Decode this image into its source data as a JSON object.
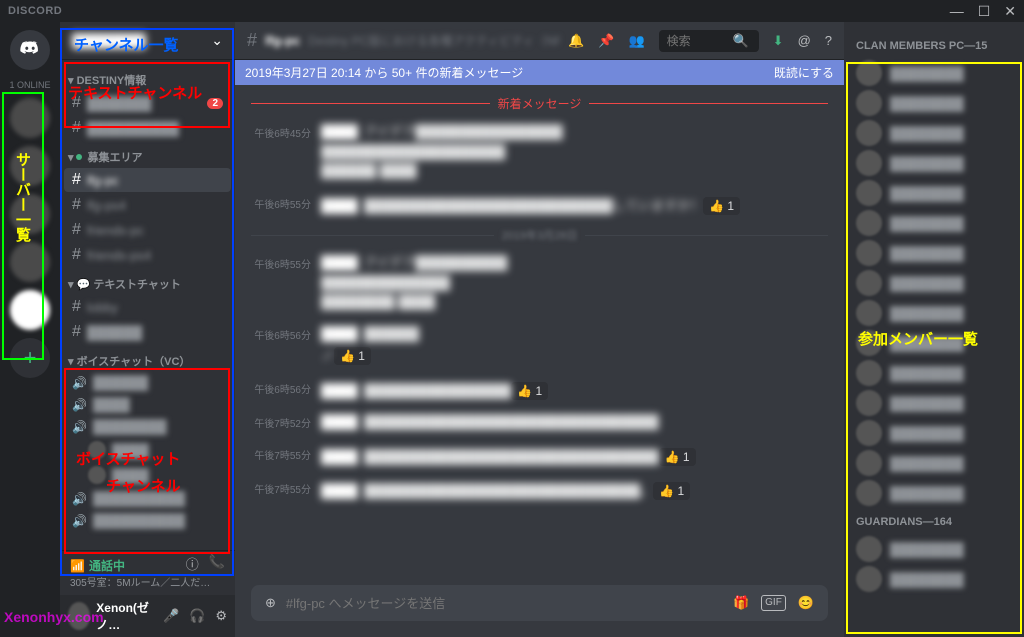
{
  "title_bar": {
    "app": "DISCORD"
  },
  "window_controls": {
    "min": "—",
    "max": "☐",
    "close": "✕"
  },
  "servers": {
    "online_label": "1 ONLINE",
    "add": "+"
  },
  "server_header": {
    "name": "████████",
    "chevron": "⌄"
  },
  "categories": [
    {
      "label": "DESTINY情報",
      "arrow": "▾",
      "channels": [
        {
          "name": "███████",
          "badge": "2"
        },
        {
          "name": "██████████"
        }
      ]
    },
    {
      "label": "募集エリア",
      "dot": true,
      "arrow": "▾",
      "channels": [
        {
          "name": "lfg-pc",
          "active": true
        },
        {
          "name": "lfg-ps4"
        },
        {
          "name": "friends-pc"
        },
        {
          "name": "friends-ps4"
        }
      ]
    },
    {
      "label": "テキストチャット",
      "arrow": "▾",
      "icon": "💬",
      "channels": [
        {
          "name": "lobby"
        },
        {
          "name": "██████"
        }
      ]
    },
    {
      "label": "ボイスチャット（VC）",
      "arrow": "▾",
      "voice": true,
      "channels": [
        {
          "name": "██████"
        },
        {
          "name": "████"
        },
        {
          "name": "████████",
          "users": 2
        },
        {
          "name": "██████████"
        },
        {
          "name": "██████████"
        }
      ]
    }
  ],
  "voice_status": {
    "connected": "通話中",
    "room": "305号室：5Mルーム／二人だ…"
  },
  "user_panel": {
    "name": "Xenon(ゼノ…"
  },
  "chat_header": {
    "channel": "lfg-pc",
    "topic": "Destiny PC版における各種アクティビティ（NF、レイド、ナイン、公開イベント、クエス…",
    "search_placeholder": "検索"
  },
  "new_banner": {
    "text": "2019年3月27日 20:14 から 50+ 件の新着メッセージ",
    "read": "既読にする"
  },
  "new_divider": "新着メッセージ",
  "messages": [
    {
      "time": "午後6時45分",
      "author": "████",
      "text": "アイデア████████████████\n████████████████████\n██████ ████"
    },
    {
      "time": "午後6時55分",
      "author": "████",
      "text": "███████████████████████████していますか！",
      "react": "👍 1"
    },
    {
      "divider": "2019年3月28日"
    },
    {
      "time": "午後6時55分",
      "author": "████",
      "text": "アイデア██████████\n██████████████\n████████ ████"
    },
    {
      "time": "午後6時56分",
      "author": "████",
      "text": "██████\nノ",
      "react": "👍 1"
    },
    {
      "time": "午後6時56分",
      "author": "████",
      "text": "████████████████",
      "react": "👍 1"
    },
    {
      "time": "午後7時52分",
      "author": "████",
      "text": "████████████████████████████████"
    },
    {
      "time": "午後7時55分",
      "author": "████",
      "text": "████████████████████████████████",
      "react": "👍 1"
    },
    {
      "time": "午後7時55分",
      "author": "████",
      "text": "██████████████████████████████。",
      "react": "👍 1"
    }
  ],
  "chat_input": {
    "placeholder": "#lfg-pc へメッセージを送信"
  },
  "members": {
    "headings": [
      {
        "label": "CLAN MEMBERS PC—15",
        "count": 15
      },
      {
        "label": "GUARDIANS—164",
        "count": 2
      }
    ]
  },
  "annotations": {
    "server_list": "サーバー一覧",
    "channel_list": "チャンネル一覧",
    "text_channel": "テキストチャンネル",
    "voice_channel": "ボイスチャット\n　　チャンネル",
    "member_list": "参加メンバー一覧"
  },
  "watermark": "Xenonhyx.com"
}
